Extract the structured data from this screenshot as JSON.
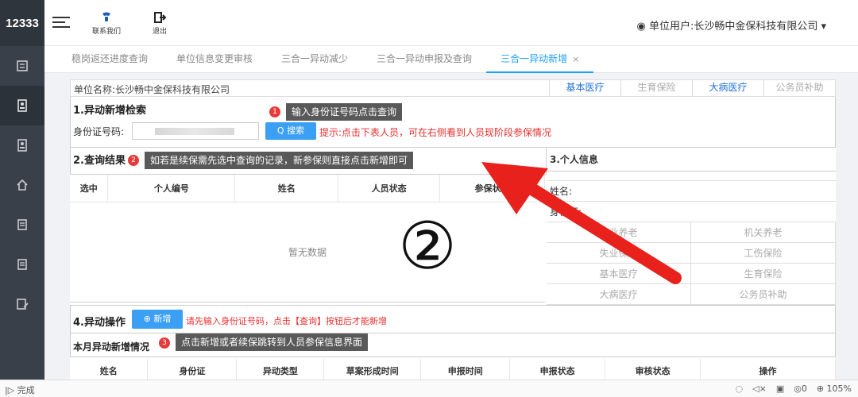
{
  "app": {
    "logo": "12333"
  },
  "header": {
    "contact_label": "联系我们",
    "logout_label": "退出",
    "user_text": "单位用户:长沙畅中金保科技有限公司"
  },
  "tabs": [
    {
      "label": "稳岗返还进度查询"
    },
    {
      "label": "单位信息变更审核"
    },
    {
      "label": "三合一异动减少"
    },
    {
      "label": "三合一异动申报及查询"
    },
    {
      "label": "三合一异动新增"
    }
  ],
  "tab_close": "×",
  "unit": {
    "name": "单位名称:长沙畅中金保科技有限公司",
    "insurance_tabs": [
      "基本医疗",
      "生育保险",
      "大病医疗",
      "公务员补助"
    ]
  },
  "section1": {
    "title": "1.异动新增检索",
    "tip": "输入身份证号码点击查询",
    "badge": "1",
    "id_label": "身份证号码:",
    "search_label": "Q 搜索",
    "hint": "提示:点击下表人员，可在右侧看到人员现阶段参保情况"
  },
  "section2": {
    "title": "2.查询结果",
    "tip": "如若是续保需先选中查询的记录，新参保则直接点击新增即可",
    "badge": "2",
    "columns": [
      "选中",
      "个人编号",
      "姓名",
      "人员状态",
      "参保状态"
    ],
    "empty_text": "暂无数据"
  },
  "section3": {
    "title": "3.个人信息",
    "name_label": "姓名:",
    "id_label": "身份证:",
    "cells": [
      "企业养老",
      "机关养老",
      "失业保险",
      "工伤保险",
      "基本医疗",
      "生育保险",
      "大病医疗",
      "公务员补助"
    ]
  },
  "section4": {
    "title": "4.异动操作",
    "add_label": "⊕ 新增",
    "hint": "请先输入身份证号码，点击【查询】按钮后才能新增"
  },
  "section5": {
    "title": "本月异动新增情况",
    "tip": "点击新增或者续保跳转到人员参保信息界面",
    "badge": "3",
    "columns": [
      "姓名",
      "身份证",
      "异动类型",
      "草案形成时间",
      "申报时间",
      "申报状态",
      "审核状态",
      "操作"
    ]
  },
  "annotation": {
    "circled": "②"
  },
  "statusbar": {
    "left": "完成",
    "count": "0",
    "zoom": "105%"
  },
  "colors": {
    "accent": "#1e9fff",
    "red": "#e62e2e",
    "sidebar": "#394049"
  }
}
